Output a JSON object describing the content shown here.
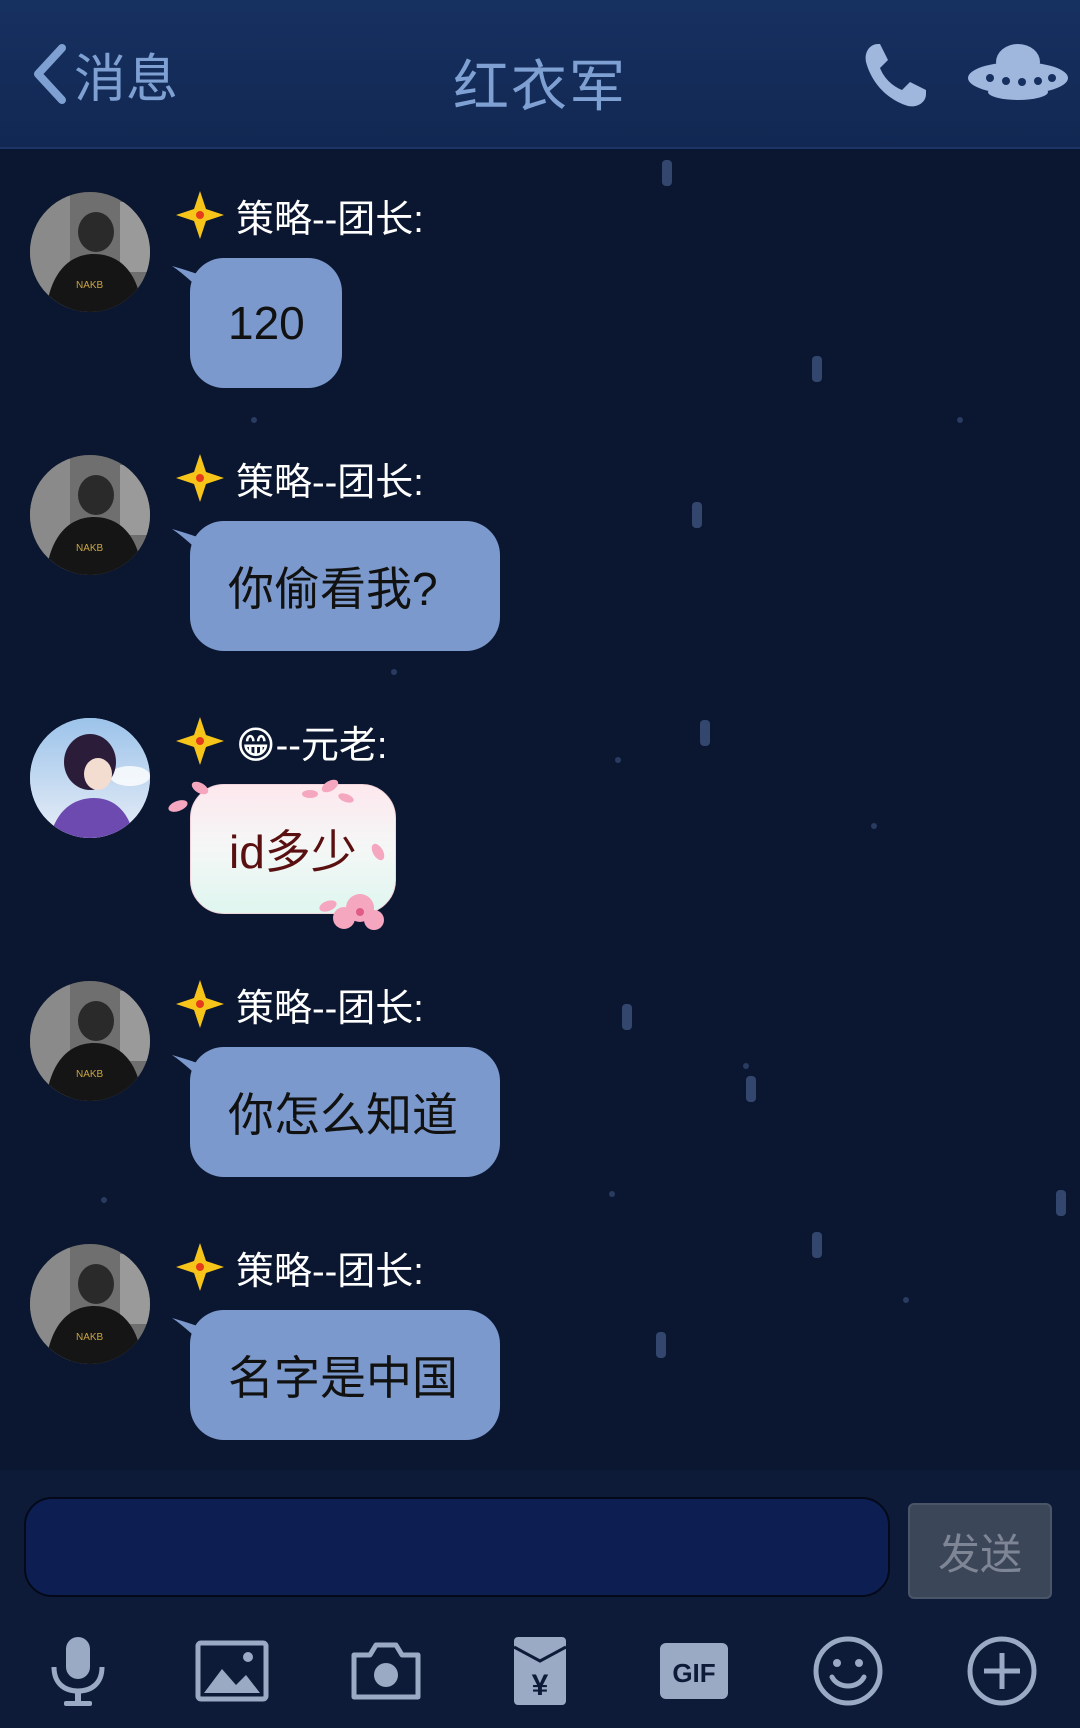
{
  "header": {
    "back_label": "消息",
    "title": "红衣军",
    "icons": [
      "back-chevron-icon",
      "phone-icon",
      "ufo-icon"
    ]
  },
  "messages": [
    {
      "sender": "策略--团长:",
      "text": "120",
      "style": "blue"
    },
    {
      "sender": "策略--团长:",
      "text": "你偷看我?",
      "style": "blue"
    },
    {
      "sender": "😁--元老:",
      "text": "id多少",
      "style": "sakura"
    },
    {
      "sender": "策略--团长:",
      "text": "你怎么知道",
      "style": "blue"
    },
    {
      "sender": "策略--团长:",
      "text": "名字是中国",
      "style": "blue"
    }
  ],
  "input": {
    "value": "",
    "placeholder": ""
  },
  "send_label": "发送",
  "toolbar": {
    "items": [
      "microphone-icon",
      "image-icon",
      "camera-icon",
      "red-packet-icon",
      "gif-icon",
      "emoji-icon",
      "plus-icon"
    ],
    "gif_label": "GIF",
    "yuan_label": "¥"
  },
  "colors": {
    "background": "#0b1730",
    "header": "#163060",
    "bubble_blue": "#7b99cc",
    "accent_text": "#7fa0d2"
  }
}
